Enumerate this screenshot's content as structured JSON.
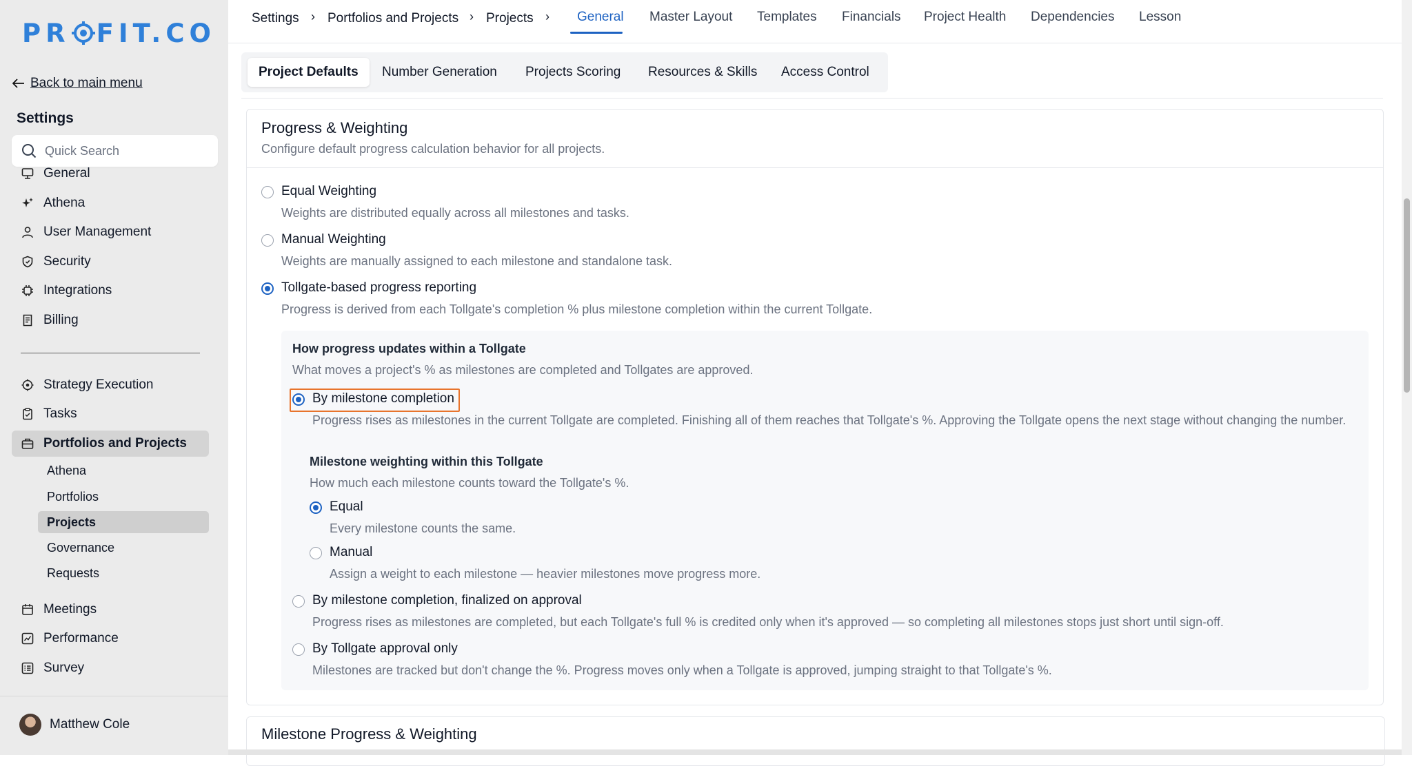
{
  "app": {
    "logo_text_left": "PR",
    "logo_text_right": "FIT.CO",
    "brand_color": "#2f80d9",
    "accent_color": "#1d62c2",
    "highlight_color": "#e8742c"
  },
  "sidebar": {
    "back_label": "Back to main menu",
    "title": "Settings",
    "search_placeholder": "Quick Search",
    "settings_items": [
      {
        "label": "General",
        "icon": "monitor-icon"
      },
      {
        "label": "Athena",
        "icon": "sparkle-icon"
      },
      {
        "label": "User Management",
        "icon": "user-icon"
      },
      {
        "label": "Security",
        "icon": "shield-icon"
      },
      {
        "label": "Integrations",
        "icon": "chip-icon"
      },
      {
        "label": "Billing",
        "icon": "receipt-icon"
      }
    ],
    "module_items": [
      {
        "label": "Strategy Execution",
        "icon": "target-icon"
      },
      {
        "label": "Tasks",
        "icon": "clipboard-icon"
      },
      {
        "label": "Portfolios and Projects",
        "icon": "briefcase-icon"
      }
    ],
    "sub_items": [
      "Athena",
      "Portfolios",
      "Projects",
      "Governance",
      "Requests"
    ],
    "bottom_items": [
      {
        "label": "Meetings",
        "icon": "calendar-icon"
      },
      {
        "label": "Performance",
        "icon": "chart-icon"
      },
      {
        "label": "Survey",
        "icon": "list-icon"
      }
    ],
    "user_name": "Matthew Cole"
  },
  "topbar": {
    "breadcrumb": [
      "Settings",
      "Portfolios and Projects",
      "Projects"
    ],
    "tabs": [
      "General",
      "Master Layout",
      "Templates",
      "Financials",
      "Project Health",
      "Dependencies",
      "Lesson"
    ],
    "active_tab": "General"
  },
  "subtabs": [
    "Project Defaults",
    "Number Generation",
    "Projects Scoring",
    "Resources & Skills",
    "Access Control"
  ],
  "progress": {
    "title": "Progress & Weighting",
    "description": "Configure default progress calculation behavior for all projects.",
    "options": [
      {
        "label": "Equal Weighting",
        "desc": "Weights are distributed equally across all milestones and tasks.",
        "selected": false
      },
      {
        "label": "Manual Weighting",
        "desc": "Weights are manually assigned to each milestone and standalone task.",
        "selected": false
      },
      {
        "label": "Tollgate-based progress reporting",
        "desc": "Progress is derived from each Tollgate's completion % plus milestone completion within the current Tollgate.",
        "selected": true
      }
    ],
    "tollgate": {
      "heading": "How progress updates within a Tollgate",
      "subheading": "What moves a project's % as milestones are completed and Tollgates are approved.",
      "opt1_label": "By milestone completion",
      "opt1_desc": "Progress rises as milestones in the current Tollgate are completed. Finishing all of them reaches that Tollgate's %. Approving the Tollgate opens the next stage without changing the number.",
      "weighting_heading": "Milestone weighting within this Tollgate",
      "weighting_sub": "How much each milestone counts toward the Tollgate's %.",
      "equal_label": "Equal",
      "equal_desc": "Every milestone counts the same.",
      "manual_label": "Manual",
      "manual_desc": "Assign a weight to each milestone — heavier milestones move progress more.",
      "opt2_label": "By milestone completion, finalized on approval",
      "opt2_desc": "Progress rises as milestones are completed, but each Tollgate's full % is credited only when it's approved — so completing all milestones stops just short until sign-off.",
      "opt3_label": "By Tollgate approval only",
      "opt3_desc": "Milestones are tracked but don't change the %. Progress moves only when a Tollgate is approved, jumping straight to that Tollgate's %."
    }
  },
  "next_section_title": "Milestone Progress & Weighting"
}
